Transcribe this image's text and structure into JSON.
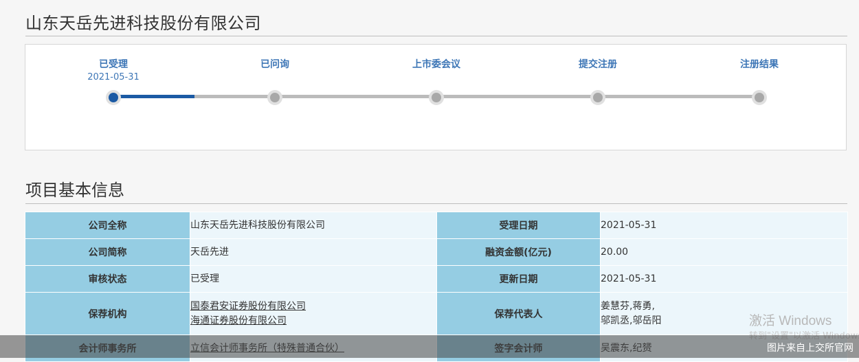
{
  "company_title": "山东天岳先进科技股份有限公司",
  "progress": {
    "steps": [
      {
        "label": "已受理",
        "date": "2021-05-31",
        "active": true
      },
      {
        "label": "已问询",
        "date": "",
        "active": false
      },
      {
        "label": "上市委会议",
        "date": "",
        "active": false
      },
      {
        "label": "提交注册",
        "date": "",
        "active": false
      },
      {
        "label": "注册结果",
        "date": "",
        "active": false
      }
    ],
    "fraction_complete": 0.125
  },
  "section_title": "项目基本信息",
  "info": {
    "rows": [
      {
        "k1": "公司全称",
        "v1": [
          "山东天岳先进科技股份有限公司"
        ],
        "v1_link": false,
        "k2": "受理日期",
        "v2": [
          "2021-05-31"
        ]
      },
      {
        "k1": "公司简称",
        "v1": [
          "天岳先进"
        ],
        "v1_link": false,
        "k2": "融资金额(亿元)",
        "v2": [
          "20.00"
        ]
      },
      {
        "k1": "审核状态",
        "v1": [
          "已受理"
        ],
        "v1_link": false,
        "k2": "更新日期",
        "v2": [
          "2021-05-31"
        ]
      },
      {
        "k1": "保荐机构",
        "v1": [
          "国泰君安证券股份有限公司",
          "海通证券股份有限公司"
        ],
        "v1_link": true,
        "k2": "保荐代表人",
        "v2": [
          "姜慧芬,蒋勇,",
          "邬凯丞,邬岳阳"
        ]
      },
      {
        "k1": "会计师事务所",
        "v1": [
          "立信会计师事务所（特殊普通合伙）"
        ],
        "v1_link": true,
        "k2": "签字会计师",
        "v2": [
          "吴震东,纪赟"
        ]
      }
    ]
  },
  "overlay": {
    "windows_activation": "激活 Windows",
    "windows_activation_sub": "转到\"设置\"以激活 Windows。",
    "source_note": "图片来自上交所官网"
  },
  "colors": {
    "accent": "#1b5aa4",
    "step_text": "#3d76b6",
    "key_cell": "#95cde3",
    "value_cell": "#ecf6fb"
  }
}
